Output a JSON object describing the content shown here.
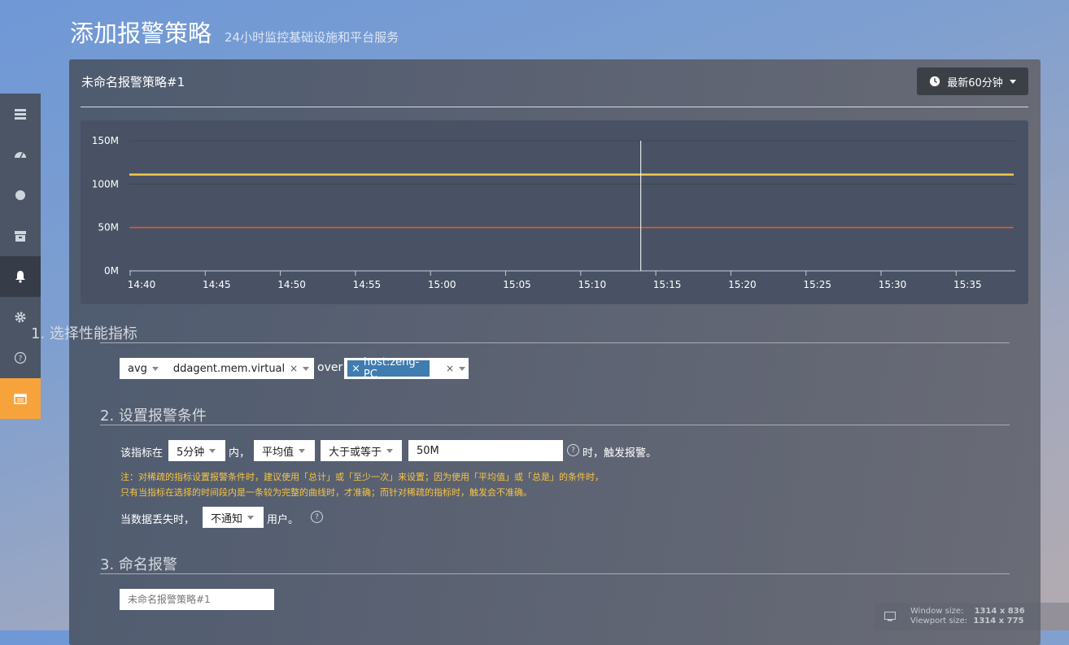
{
  "header": {
    "title": "添加报警策略",
    "subtitle": "24小时监控基础设施和平台服务"
  },
  "sidebar": {
    "items": [
      {
        "icon": "list-icon"
      },
      {
        "icon": "dashboard-icon"
      },
      {
        "icon": "dot-icon"
      },
      {
        "icon": "archive-icon"
      },
      {
        "icon": "bell-icon",
        "active": true
      },
      {
        "icon": "gear-icon"
      },
      {
        "icon": "question-icon"
      },
      {
        "icon": "calendar-icon",
        "highlight": true
      }
    ]
  },
  "panel": {
    "title": "未命名报警策略#1",
    "time_range": "最新60分钟"
  },
  "chart_data": {
    "type": "line",
    "x": [
      "14:40",
      "14:45",
      "14:50",
      "14:55",
      "15:00",
      "15:05",
      "15:10",
      "15:15",
      "15:20",
      "15:25",
      "15:30",
      "15:35"
    ],
    "yticks": [
      "150M",
      "100M",
      "50M",
      "0M"
    ],
    "ylim": [
      0,
      150
    ],
    "series": [
      {
        "color": "#f2c94c",
        "values": [
          111,
          111,
          111,
          111,
          111,
          111,
          111,
          111,
          111,
          111,
          111,
          111
        ]
      },
      {
        "color": "#e2572c",
        "values": [
          50,
          50,
          50,
          50,
          50,
          50,
          50,
          50,
          50,
          50,
          50,
          50
        ]
      }
    ],
    "cursor_time": "15:14"
  },
  "section1": {
    "heading": "1. 选择性能指标",
    "aggregation": "avg",
    "metric": "ddagent.mem.virtual",
    "over_label": "over",
    "host_tag": "host:zeng-PC",
    "clear_symbol": "×"
  },
  "section2": {
    "heading": "2. 设置报警条件",
    "prefix": "该指标在",
    "window": "5分钟",
    "inner": "内，",
    "func": "平均值",
    "comparator": "大于或等于",
    "threshold": "50M",
    "suffix": "时，触发报警。",
    "note_line1": "注：对稀疏的指标设置报警条件时，建议使用「总计」或「至少一次」来设置；因为使用「平均值」或「总是」的条件时，",
    "note_line2": "只有当指标在选择的时间段内是一条较为完整的曲线时，才准确；而针对稀疏的指标时，触发会不准确。",
    "nodata_prefix": "当数据丢失时，",
    "nodata_value": "不通知",
    "nodata_suffix": "用户。",
    "help_symbol": "?"
  },
  "section3": {
    "heading": "3. 命名报警",
    "name_placeholder": "未命名报警策略#1"
  },
  "status": {
    "window_label": "Window size:",
    "window_value": "1314 x 836",
    "viewport_label": "Viewport size:",
    "viewport_value": "1314 x 775"
  }
}
